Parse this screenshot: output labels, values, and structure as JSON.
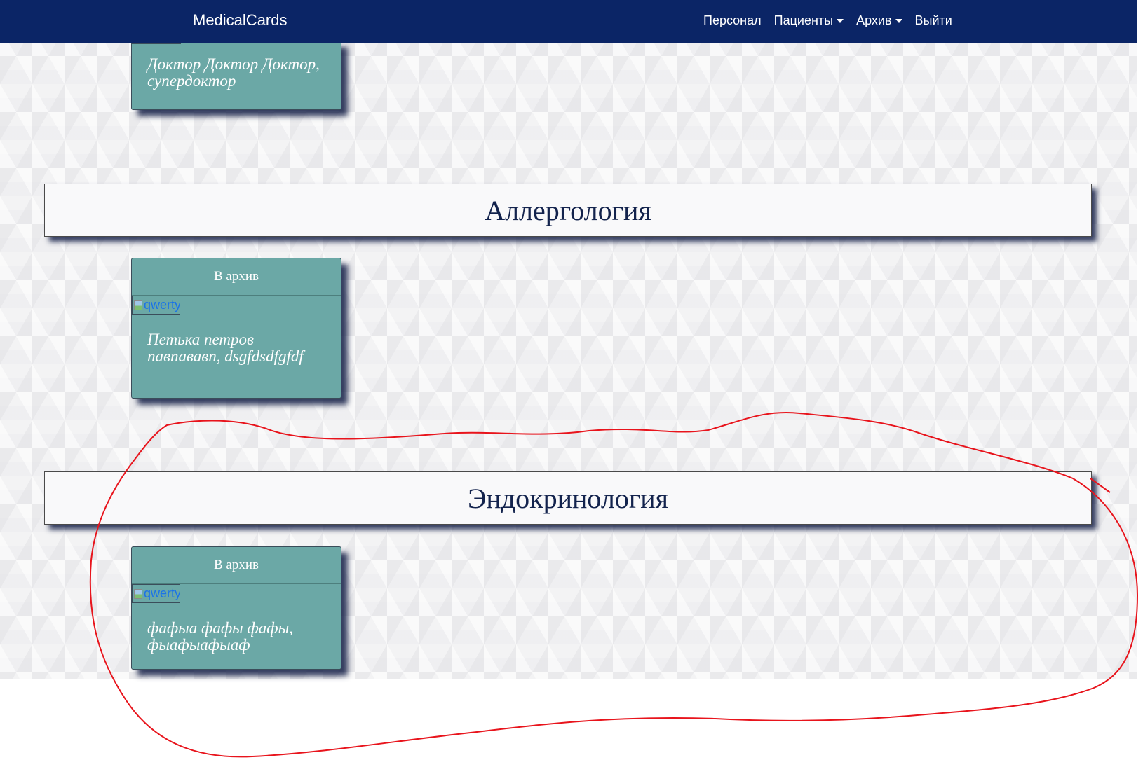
{
  "navbar": {
    "brand": "MedicalCards",
    "links": [
      {
        "label": "Персонал",
        "has_dropdown": false
      },
      {
        "label": "Пациенты",
        "has_dropdown": true
      },
      {
        "label": "Архив",
        "has_dropdown": true
      },
      {
        "label": "Выйти",
        "has_dropdown": false
      }
    ]
  },
  "cards_top": {
    "name": "Доктор Доктор Доктор, супердоктор"
  },
  "sections": [
    {
      "title": "Аллергология",
      "card": {
        "archive_button": "В архив",
        "image_alt": "qwerty",
        "name": "Петька петров павпававп, dsgfdsdfgfdf"
      }
    },
    {
      "title": "Эндокринология",
      "card": {
        "archive_button": "В архив",
        "image_alt": "qwerty",
        "name": "фафыа фафы фафы, фыафыафыаф"
      }
    }
  ],
  "colors": {
    "navbar": "#0b2566",
    "card": "#6ba8a6",
    "section_title": "#13234d",
    "annotation": "#e8141c"
  }
}
